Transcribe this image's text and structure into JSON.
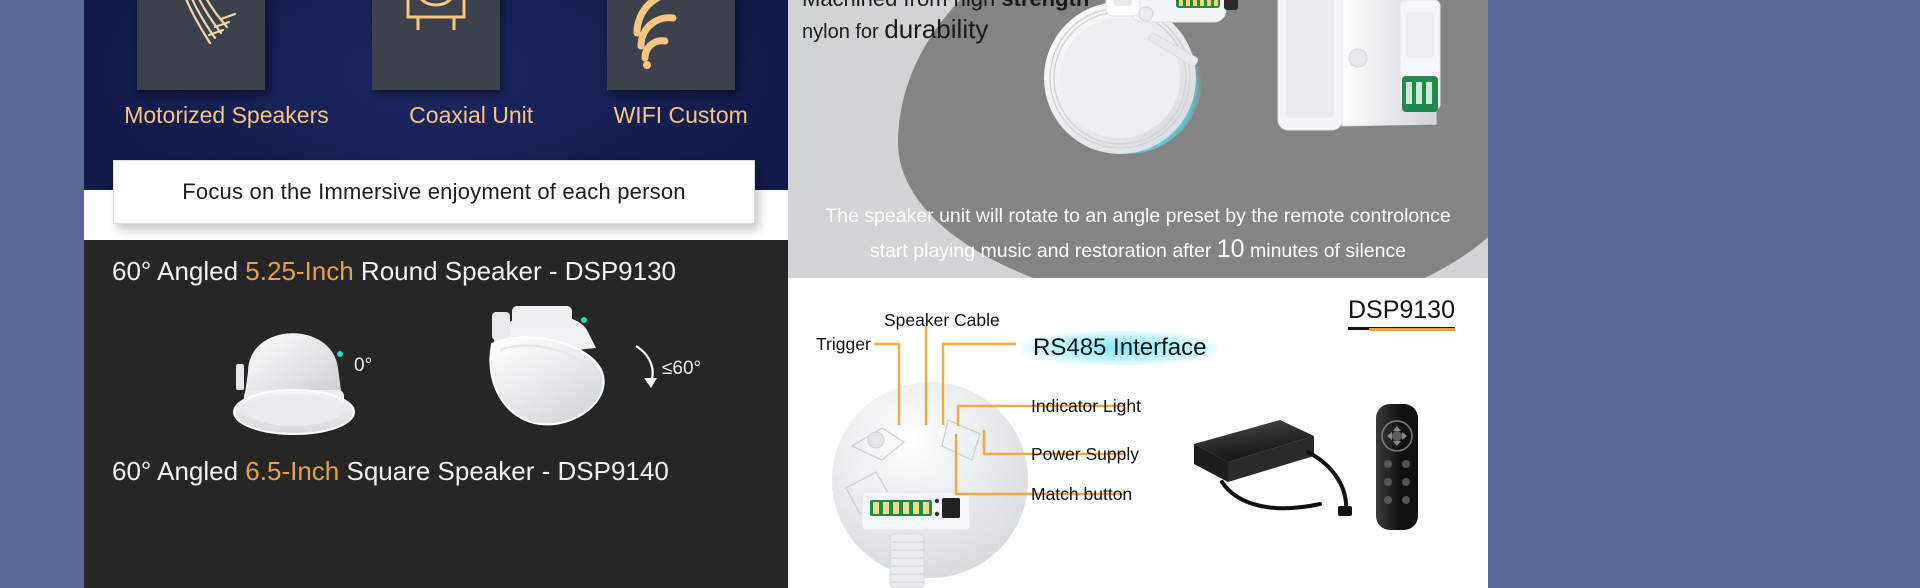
{
  "left": {
    "feature_icons": [
      {
        "label": "Motorized Speakers",
        "icon": "motorized-speaker-icon"
      },
      {
        "label": "Coaxial Unit",
        "icon": "coaxial-speaker-icon"
      },
      {
        "label": "WIFI Custom",
        "icon": "wifi-icon"
      }
    ],
    "quote": "Focus on the Immersive enjoyment of each person",
    "product_1": {
      "prefix": "60° Angled ",
      "accent": "5.25-Inch",
      "suffix": " Round Speaker -  DSP9130",
      "angle_flat": "0°",
      "angle_tilt": "≤60°"
    },
    "product_2": {
      "prefix": "60° Angled ",
      "accent": "6.5-Inch",
      "suffix": " Square Speaker -  DSP9140"
    }
  },
  "right": {
    "machined_line1_a": "Machined from high ",
    "machined_line1_b": "strength",
    "machined_line2_a": "nylon for ",
    "machined_line2_b": "durability",
    "rotate_line1": "The speaker unit will rotate to an angle preset by the remote controlonce",
    "rotate_line2_a": "start playing music and restoration after ",
    "rotate_line2_num": "10",
    "rotate_line2_b": " minutes of silence",
    "model_title": "DSP9130",
    "callouts": [
      {
        "name": "trigger",
        "label": "Trigger"
      },
      {
        "name": "speaker-cable",
        "label": "Speaker Cable"
      },
      {
        "name": "rs485-interface",
        "label": "RS485 Interface"
      },
      {
        "name": "indicator-light",
        "label": "Indicator Light"
      },
      {
        "name": "power-supply",
        "label": "Power Supply"
      },
      {
        "name": "match-button",
        "label": "Match button"
      }
    ]
  },
  "colors": {
    "navy": "#141c4f",
    "gold": "#f4c07a",
    "accent_orange": "#e5a24a",
    "dark_panel": "#262626",
    "gray_panel": "#d2d3d4",
    "gray_blob": "#848484",
    "callout_line": "#F2A93B",
    "page_bg": "#5a6a96",
    "rs485_glow": "#78ebff"
  }
}
